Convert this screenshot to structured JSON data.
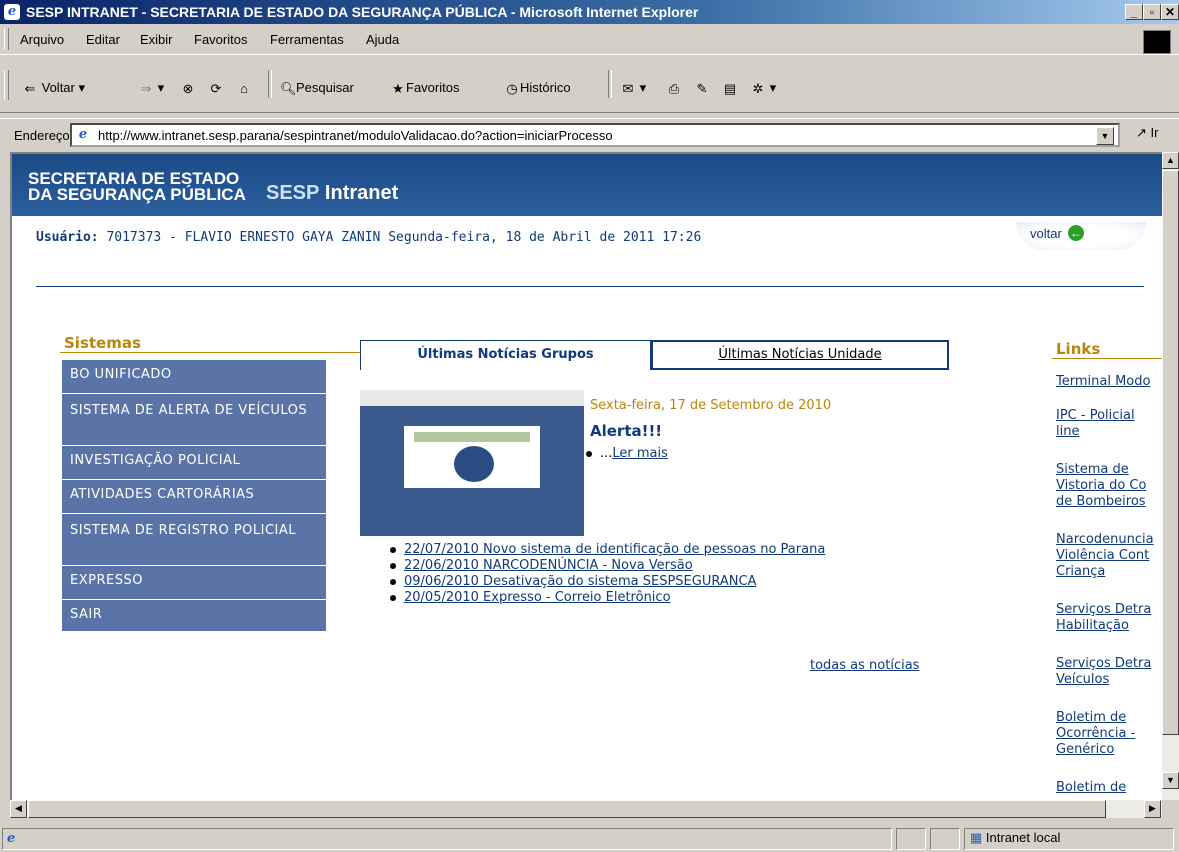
{
  "window": {
    "title": "SESP INTRANET - SECRETARIA DE ESTADO DA SEGURANÇA PÚBLICA - Microsoft Internet Explorer"
  },
  "menu": [
    "Arquivo",
    "Editar",
    "Exibir",
    "Favoritos",
    "Ferramentas",
    "Ajuda"
  ],
  "toolbar": {
    "back": "Voltar",
    "search": "Pesquisar",
    "favorites": "Favoritos",
    "history": "Histórico"
  },
  "address": {
    "label": "Endereço",
    "url": "http://www.intranet.sesp.parana/sespintranet/moduloValidacao.do?action=iniciarProcesso",
    "go": "Ir"
  },
  "header": {
    "org_line1": "SECRETARIA DE ESTADO",
    "org_line2": "DA SEGURANÇA PÚBLICA",
    "app_a": "SESP",
    "app_b": " Intranet"
  },
  "user": {
    "label": "Usuário:",
    "value": "7017373 - FLAVIO ERNESTO GAYA ZANIN  Segunda-feira, 18 de Abril de 2011 17:26"
  },
  "voltar": "voltar",
  "sistemas": {
    "title": "Sistemas",
    "items": [
      "BO UNIFICADO",
      "SISTEMA DE ALERTA DE VEÍCULOS",
      "INVESTIGAÇÃO POLICIAL",
      "ATIVIDADES CARTORÁRIAS",
      "SISTEMA DE REGISTRO POLICIAL",
      "EXPRESSO",
      "SAIR"
    ]
  },
  "tabs": {
    "groups": "Últimas Notícias Grupos",
    "unit": "Últimas Notícias Unidade"
  },
  "featured": {
    "date": "Sexta-feira, 17 de Setembro de 2010",
    "title": "Alerta!!!",
    "more_prefix": "...",
    "more": "Ler mais"
  },
  "news": [
    "22/07/2010 Novo sistema de identificação de pessoas no Parana",
    "22/06/2010 NARCODENÚNCIA - Nova Versão",
    "09/06/2010 Desativação do sistema SESPSEGURANCA",
    "20/05/2010 Expresso - Correio Eletrônico"
  ],
  "all_news": "todas as notícias",
  "links": {
    "title": "Links",
    "items": [
      [
        "Terminal Modo"
      ],
      [
        "IPC - Policial",
        "line"
      ],
      [
        "Sistema de",
        "Vistoria do Co",
        "de Bombeiros"
      ],
      [
        "Narcodenuncia",
        "Violência Cont",
        "Criança"
      ],
      [
        "Serviços Detra",
        "Habilitação"
      ],
      [
        "Serviços Detra",
        "Veículos"
      ],
      [
        "Boletim de",
        "Ocorrência -",
        "Genérico"
      ],
      [
        "Boletim de"
      ]
    ]
  },
  "status": {
    "zone": "Intranet local"
  }
}
